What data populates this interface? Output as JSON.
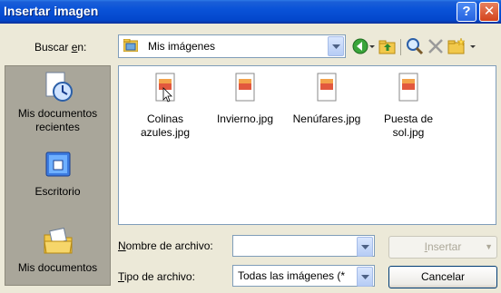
{
  "window": {
    "title": "Insertar imagen",
    "help_glyph": "?",
    "close_glyph": "✕"
  },
  "lookin": {
    "label_prefix": "Buscar ",
    "label_accel": "e",
    "label_suffix": "n:",
    "value": "Mis imágenes"
  },
  "toolbar": {
    "icons": [
      "back-icon",
      "dropdown-icon",
      "up-folder-icon",
      "search-web-icon",
      "delete-icon",
      "new-folder-icon"
    ]
  },
  "places": [
    {
      "label": "Mis documentos recientes",
      "icon": "recent-documents-icon"
    },
    {
      "label": "Escritorio",
      "icon": "desktop-icon"
    },
    {
      "label": "Mis documentos",
      "icon": "my-documents-icon"
    }
  ],
  "files": [
    {
      "name": "Colinas azules.jpg"
    },
    {
      "name": "Invierno.jpg"
    },
    {
      "name": "Nenúfares.jpg"
    },
    {
      "name": "Puesta de sol.jpg"
    }
  ],
  "filename": {
    "label_accel": "N",
    "label_rest": "ombre de archivo:",
    "value": ""
  },
  "filetype": {
    "label_accel": "T",
    "label_rest": "ipo de archivo:",
    "value": "Todas las imágenes (*"
  },
  "buttons": {
    "insert_accel": "I",
    "insert_rest": "nsertar",
    "insert_dropdown": "▼",
    "cancel": "Cancelar"
  },
  "colors": {
    "titlebar": "#0a53d8",
    "places_bg": "#a9a69a",
    "dialog_bg": "#ece9d8"
  }
}
